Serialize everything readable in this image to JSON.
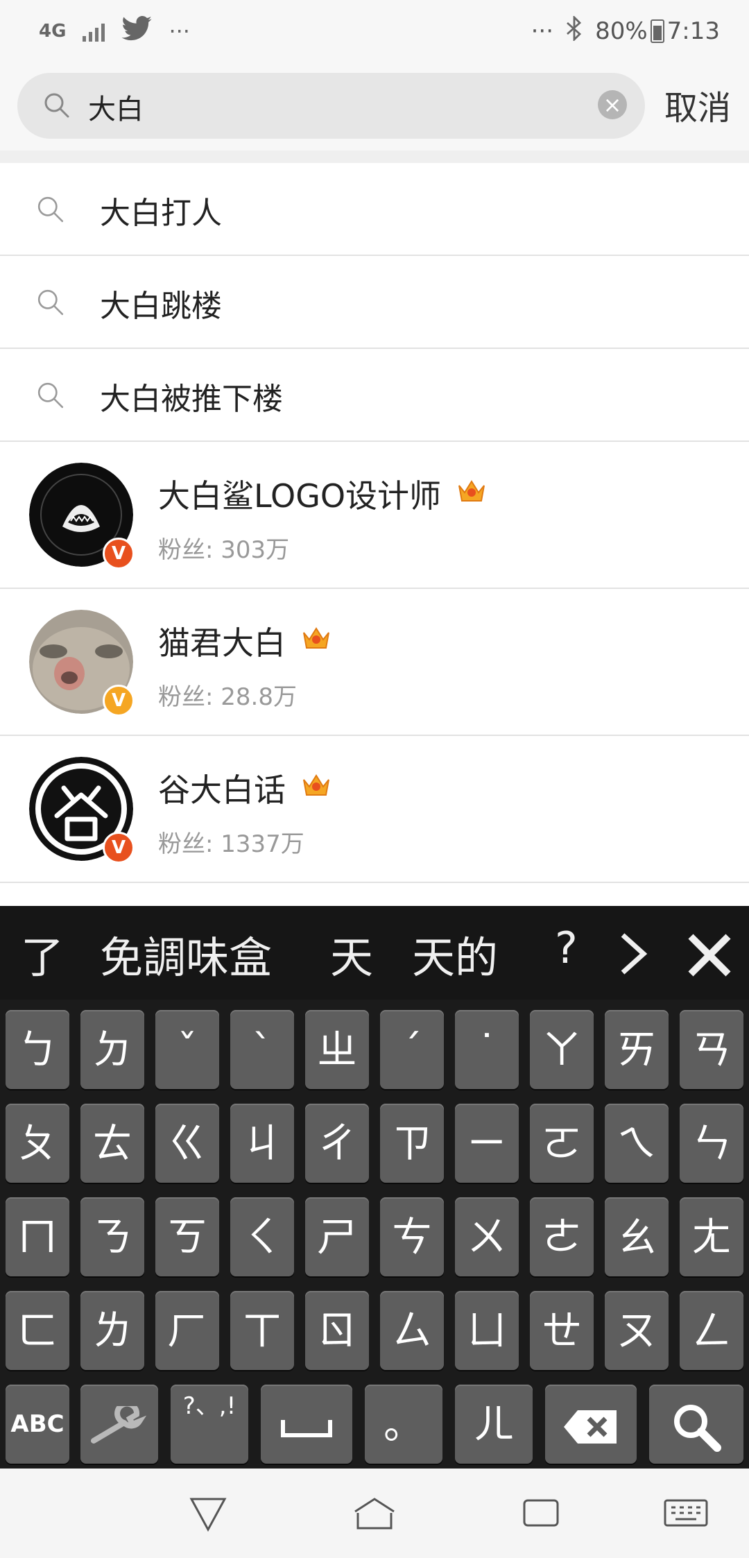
{
  "status": {
    "network": "4G",
    "more_left": "···",
    "more_right": "···",
    "battery": "80%",
    "time": "7:13"
  },
  "search": {
    "query": "大白",
    "placeholder": "",
    "cancel_label": "取消"
  },
  "suggestions": [
    "大白打人",
    "大白跳楼",
    "大白被推下楼"
  ],
  "users": [
    {
      "name": "大白鲨LOGO设计师",
      "fans": "粉丝: 303万",
      "badge_color": "#e8501e"
    },
    {
      "name": "猫君大白",
      "fans": "粉丝: 28.8万",
      "badge_color": "#f5a623"
    },
    {
      "name": "谷大白话",
      "fans": "粉丝: 1337万",
      "badge_color": "#e8501e"
    }
  ],
  "keyboard": {
    "candidates": [
      "了",
      "免調味盒",
      "天",
      "天的",
      "?"
    ],
    "rows": [
      [
        "ㄅ",
        "ㄉ",
        "ˇ",
        "ˋ",
        "ㄓ",
        "ˊ",
        "˙",
        "ㄚ",
        "ㄞ",
        "ㄢ"
      ],
      [
        "ㄆ",
        "ㄊ",
        "ㄍ",
        "ㄐ",
        "ㄔ",
        "ㄗ",
        "ㄧ",
        "ㄛ",
        "ㄟ",
        "ㄣ"
      ],
      [
        "ㄇ",
        "ㄋ",
        "ㄎ",
        "ㄑ",
        "ㄕ",
        "ㄘ",
        "ㄨ",
        "ㄜ",
        "ㄠ",
        "ㄤ"
      ],
      [
        "ㄈ",
        "ㄌ",
        "ㄏ",
        "ㄒ",
        "ㄖ",
        "ㄙ",
        "ㄩ",
        "ㄝ",
        "ㄡ",
        "ㄥ"
      ]
    ],
    "bottom": {
      "abc": "ABC",
      "punct": "?、,!",
      "period": "。",
      "er": "ㄦ"
    }
  },
  "colors": {
    "accent": "#f5a623",
    "keyboard_bg": "#1b1b1b",
    "key_bg": "#5e5e5e"
  }
}
